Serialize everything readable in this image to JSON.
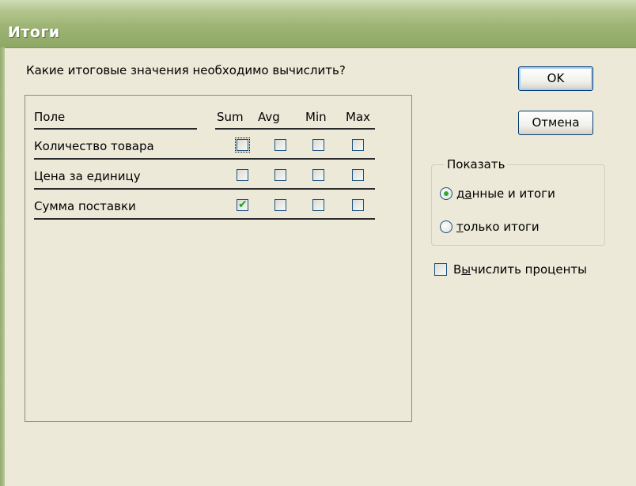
{
  "window": {
    "title": "Итоги"
  },
  "question": "Какие итоговые значения необходимо вычислить?",
  "table": {
    "headers": {
      "field": "Поле",
      "cols": [
        "Sum",
        "Avg",
        "Min",
        "Max"
      ]
    },
    "rows": [
      {
        "label": "Количество товара",
        "checks": [
          false,
          false,
          false,
          false
        ]
      },
      {
        "label": "Цена за единицу",
        "checks": [
          false,
          false,
          false,
          false
        ]
      },
      {
        "label": "Сумма поставки",
        "checks": [
          true,
          false,
          false,
          false
        ]
      }
    ]
  },
  "buttons": {
    "ok": "OK",
    "cancel": "Отмена"
  },
  "show_group": {
    "title": "Показать",
    "options": [
      {
        "pre": "д",
        "ul": "а",
        "post": "нные и итоги",
        "selected": true
      },
      {
        "pre": "",
        "ul": "т",
        "post": "олько итоги",
        "selected": false
      }
    ]
  },
  "percent": {
    "pre": "В",
    "ul": "ы",
    "post": "числить проценты",
    "checked": false
  },
  "colors": {
    "title_bar": "#9db474",
    "dialog_bg": "#ECE9D8",
    "check_mark": "#21a121"
  }
}
